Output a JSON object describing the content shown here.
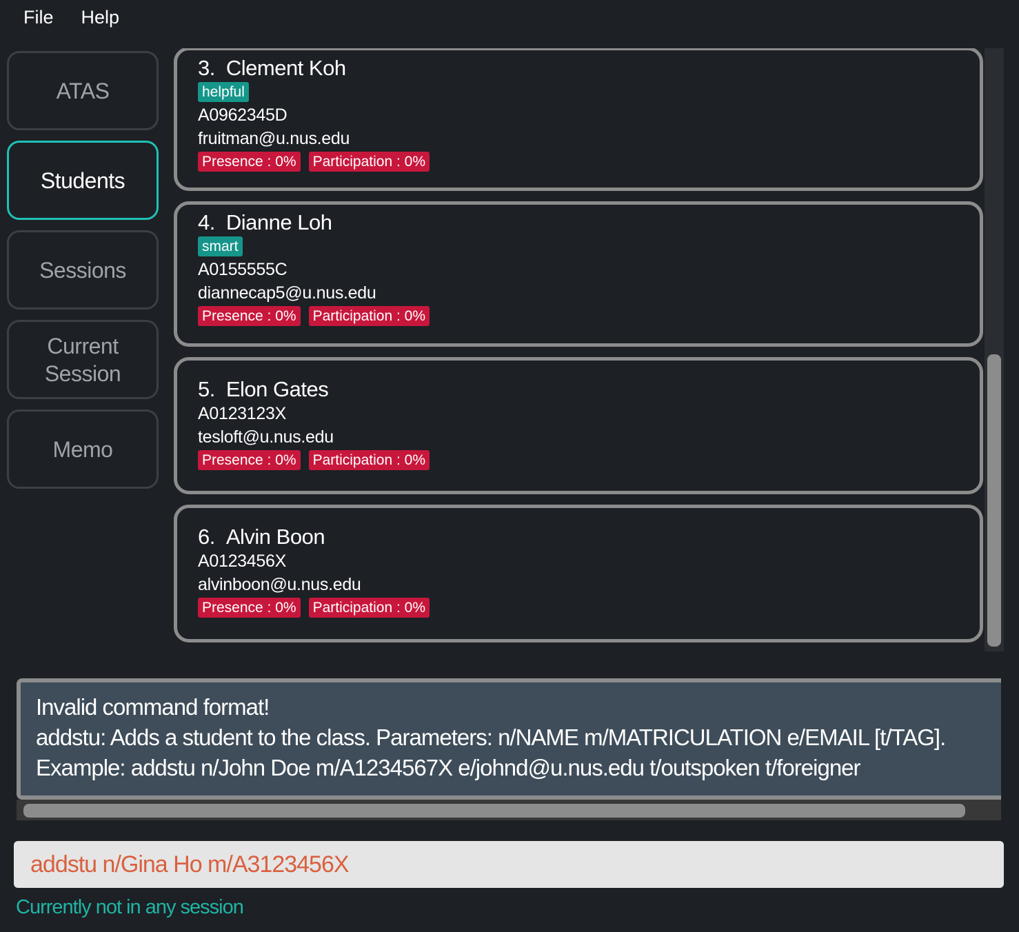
{
  "menu": {
    "file": "File",
    "help": "Help"
  },
  "nav": {
    "atas": "ATAS",
    "students": "Students",
    "sessions": "Sessions",
    "current_session": "Current Session",
    "memo": "Memo",
    "active": "Students"
  },
  "students": [
    {
      "index": "3.",
      "name": "Clement Koh",
      "tags": [
        "helpful"
      ],
      "matric": "A0962345D",
      "email": "fruitman@u.nus.edu",
      "presence": "Presence : 0%",
      "participation": "Participation : 0%"
    },
    {
      "index": "4.",
      "name": "Dianne Loh",
      "tags": [
        "smart"
      ],
      "matric": "A0155555C",
      "email": "diannecap5@u.nus.edu",
      "presence": "Presence : 0%",
      "participation": "Participation : 0%"
    },
    {
      "index": "5.",
      "name": "Elon Gates",
      "tags": [],
      "matric": "A0123123X",
      "email": "tesloft@u.nus.edu",
      "presence": "Presence : 0%",
      "participation": "Participation : 0%"
    },
    {
      "index": "6.",
      "name": "Alvin Boon",
      "tags": [],
      "matric": "A0123456X",
      "email": "alvinboon@u.nus.edu",
      "presence": "Presence : 0%",
      "participation": "Participation : 0%"
    }
  ],
  "result": {
    "lines": [
      "Invalid command format!",
      "addstu: Adds a student to the class. Parameters: n/NAME m/MATRICULATION e/EMAIL [t/TAG].",
      "Example: addstu n/John Doe m/A1234567X e/johnd@u.nus.edu t/outspoken t/foreigner"
    ]
  },
  "command": {
    "value": "addstu n/Gina Ho m/A3123456X"
  },
  "status": {
    "text": "Currently not in any session"
  },
  "colors": {
    "accent": "#1fc1b5",
    "tag": "#16968a",
    "attendance": "#c8173c",
    "command_error": "#d9603f"
  }
}
